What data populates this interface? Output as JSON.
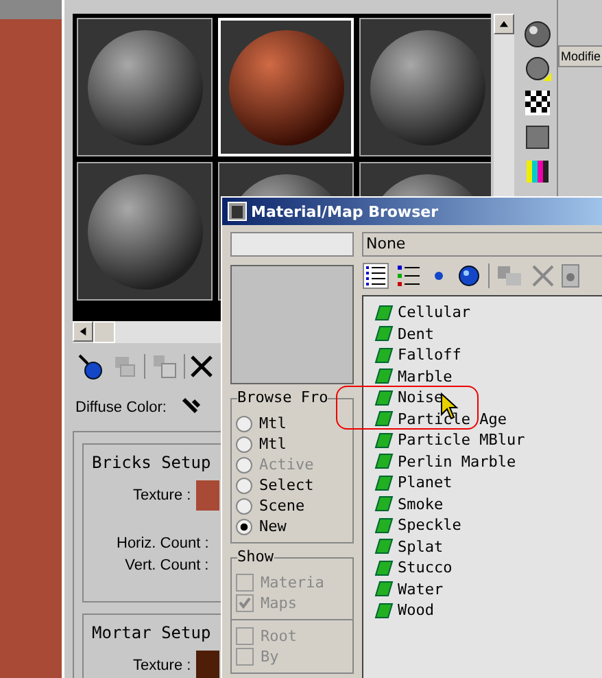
{
  "editor": {
    "sample_slots": [
      {
        "kind": "gray",
        "selected": false
      },
      {
        "kind": "brick",
        "selected": true
      },
      {
        "kind": "gray",
        "selected": false
      },
      {
        "kind": "gray",
        "selected": false
      },
      {
        "kind": "gray",
        "selected": false
      },
      {
        "kind": "gray",
        "selected": false
      }
    ],
    "diffuse_label": "Diffuse Color:",
    "groups": [
      {
        "title": "Bricks Setup",
        "texture_label": "Texture :",
        "color": "#a84a35",
        "counts": [
          "Horiz. Count :",
          "Vert. Count :"
        ]
      },
      {
        "title": "Mortar Setup",
        "texture_label": "Texture :",
        "color": "#4e1e08"
      }
    ]
  },
  "side_panel": {
    "tab": "Modifie"
  },
  "browser": {
    "title": "Material/Map Browser",
    "name_field": "None",
    "browse_from": {
      "title": "Browse Fro",
      "options": [
        {
          "label": "Mtl",
          "selected": false,
          "disabled": false
        },
        {
          "label": "Mtl",
          "selected": false,
          "disabled": false
        },
        {
          "label": "Active",
          "selected": false,
          "disabled": true
        },
        {
          "label": "Select",
          "selected": false,
          "disabled": false
        },
        {
          "label": "Scene",
          "selected": false,
          "disabled": false
        },
        {
          "label": "New",
          "selected": true,
          "disabled": false
        }
      ]
    },
    "show": {
      "title": "Show",
      "options": [
        {
          "label": "Materia",
          "checked": false,
          "disabled": true
        },
        {
          "label": "Maps",
          "checked": true,
          "disabled": true
        }
      ],
      "extra": [
        {
          "label": "Root",
          "checked": false,
          "disabled": true
        },
        {
          "label": "By",
          "checked": false,
          "disabled": true
        }
      ]
    },
    "maps": [
      "Cellular",
      "Dent",
      "Falloff",
      "Marble",
      "Noise",
      "Particle Age",
      "Particle MBlur",
      "Perlin Marble",
      "Planet",
      "Smoke",
      "Speckle",
      "Splat",
      "Stucco",
      "Water",
      "Wood"
    ]
  }
}
